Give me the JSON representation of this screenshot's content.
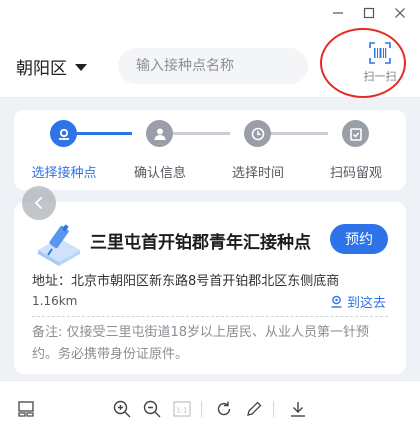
{
  "window": {
    "min_icon": "minimize-icon",
    "max_icon": "maximize-icon",
    "close_icon": "close-icon"
  },
  "header": {
    "district": "朝阳区",
    "search_placeholder": "输入接种点名称",
    "scan_label": "扫一扫",
    "scan_icon": "barcode-scan-icon",
    "highlight_color": "#e52b26"
  },
  "steps": [
    {
      "label": "选择接种点",
      "icon": "location-icon",
      "active": true
    },
    {
      "label": "确认信息",
      "icon": "person-icon",
      "active": false
    },
    {
      "label": "选择时间",
      "icon": "clock-icon",
      "active": false
    },
    {
      "label": "扫码留观",
      "icon": "clipboard-check-icon",
      "active": false
    }
  ],
  "site": {
    "name": "三里屯首开铂郡青年汇接种点",
    "book_label": "预约",
    "address": "地址：北京市朝阳区新东路8号首开铂郡北区东侧底商",
    "distance": "1.16km",
    "navigate_label": "到这去",
    "note": "备注: 仅接受三里屯街道18岁以上居民、从业人员第一针预约。务必携带身份证原件。"
  },
  "toolbar": {
    "icons": [
      "thumbnail-view-icon",
      "zoom-in-icon",
      "zoom-out-icon",
      "actual-size-icon",
      "rotate-icon",
      "edit-icon",
      "download-icon"
    ],
    "actual_size_label": "1:1"
  },
  "colors": {
    "accent": "#2f73e8",
    "inactive_step": "#9a9ea8",
    "page_bg": "#eef1f6"
  }
}
